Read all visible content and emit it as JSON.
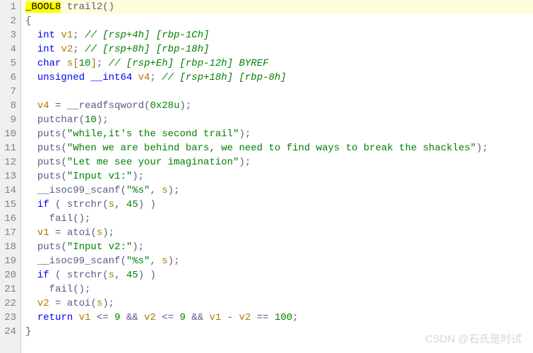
{
  "lines": [
    {
      "num": 1
    },
    {
      "num": 2
    },
    {
      "num": 3
    },
    {
      "num": 4
    },
    {
      "num": 5
    },
    {
      "num": 6
    },
    {
      "num": 7
    },
    {
      "num": 8
    },
    {
      "num": 9
    },
    {
      "num": 10
    },
    {
      "num": 11
    },
    {
      "num": 12
    },
    {
      "num": 13
    },
    {
      "num": 14
    },
    {
      "num": 15
    },
    {
      "num": 16
    },
    {
      "num": 17
    },
    {
      "num": 18
    },
    {
      "num": 19
    },
    {
      "num": 20
    },
    {
      "num": 21
    },
    {
      "num": 22
    },
    {
      "num": 23
    },
    {
      "num": 24
    }
  ],
  "tok": {
    "ret_type": "_BOOL8",
    "fn_name": "trail2",
    "fn_paren": "()",
    "brace_open": "{",
    "brace_close": "}",
    "indent2": "  ",
    "indent4": "    ",
    "kw_int": "int",
    "kw_char": "char",
    "kw_unsigned": "unsigned",
    "kw_int64": "__int64",
    "kw_if": "if",
    "kw_return": "return",
    "v1": "v1",
    "v2": "v2",
    "v4": "v4",
    "s": "s",
    "s_decl": "s[",
    "s_decl_close": "]",
    "s_size": "10",
    "semi": ";",
    "space": " ",
    "cm_v1": "// [rsp+4h] [rbp-1Ch]",
    "cm_v2": "// [rsp+8h] [rbp-18h]",
    "cm_s": "// [rsp+Eh] [rbp-12h] BYREF",
    "cm_v4": "// [rsp+18h] [rbp-8h]",
    "eq": " = ",
    "readfsq": "__readfsqword",
    "readfsq_arg": "0x28u",
    "putchar": "putchar",
    "putchar_arg": "10",
    "puts": "puts",
    "str1": "\"while,it's the second trail\"",
    "str2": "\"When we are behind bars, we need to find ways to break the shackles\"",
    "str3": "\"Let me see your imagination\"",
    "str4": "\"Input v1:\"",
    "str5": "\"Input v2:\"",
    "scanf": "__isoc99_scanf",
    "fmt_s": "\"%s\"",
    "strchr": "strchr",
    "strchr_n": "45",
    "fail": "fail",
    "atoi": "atoi",
    "lparen": "(",
    "rparen": ")",
    "comma": ", ",
    "le": " <= ",
    "nine": "9",
    "and": " && ",
    "minus": " - ",
    "eqeq": " == ",
    "hundred": "100"
  },
  "watermark": "CSDN @石氏是时试"
}
